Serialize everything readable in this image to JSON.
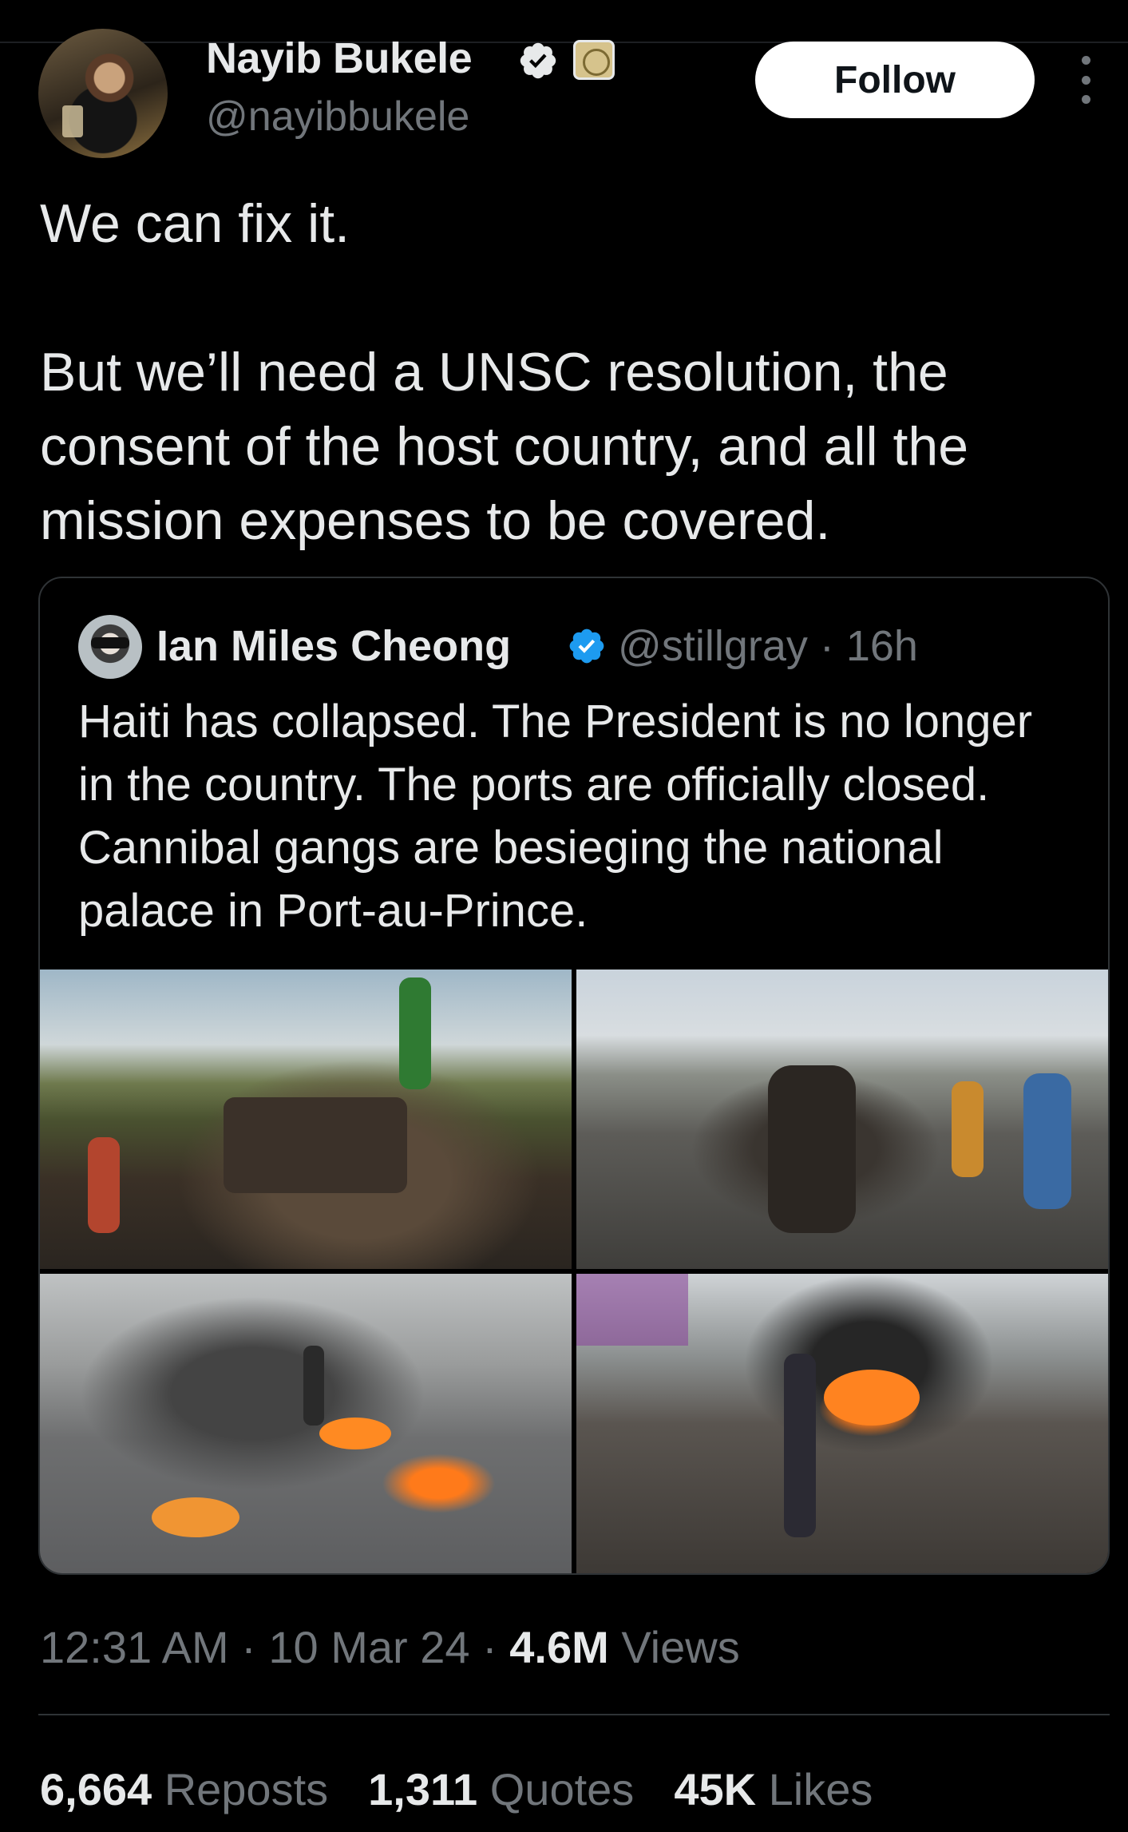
{
  "author": {
    "display_name": "Nayib Bukele",
    "handle": "@nayibbukele",
    "verified_color": "#1d9bf0"
  },
  "header": {
    "follow_label": "Follow",
    "more_icon": "more-vertical-icon"
  },
  "tweet": {
    "paragraph_1": "We can fix it.",
    "paragraph_2": "But we’ll need a UNSC resolution, the consent of the host country, and all the mission expenses to be covered."
  },
  "quoted_tweet": {
    "display_name": "Ian Miles Cheong",
    "handle_time": "@stillgray · 16h",
    "text": "Haiti has collapsed. The President is no longer in the country. The ports are officially closed. Cannibal gangs are besieging the national palace in Port-au-Prince.",
    "photo_count": 4
  },
  "meta": {
    "time_date": "12:31 AM · 10 Mar 24 · ",
    "views_count": "4.6M",
    "views_label": " Views"
  },
  "stats": {
    "reposts_count": "6,664",
    "reposts_label": "Reposts",
    "quotes_count": "1,311",
    "quotes_label": "Quotes",
    "likes_count": "45K",
    "likes_label": "Likes"
  }
}
